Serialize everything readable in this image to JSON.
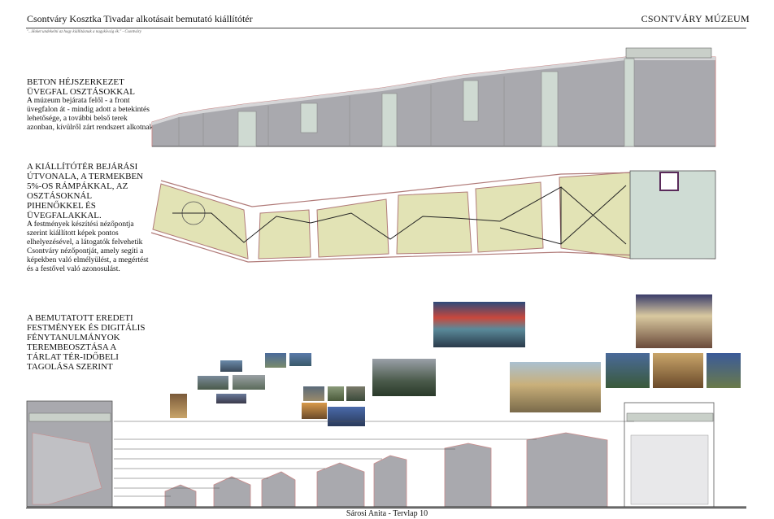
{
  "header": {
    "title": "Csontváry Kosztka Tivadar alkotásait bemutató kiállítótér",
    "right": "CSONTVÁRY MÚZEUM",
    "quote": "\"...Hoket undekelni az hogy kiállításnak a nagykövsig ék.\" - Csontváry"
  },
  "section1": {
    "title": "BETON HÉJSZERKEZET ÜVEGFAL OSZTÁSOKKAL",
    "body": "A múzeum bejárata felől - a front üvegfalon át - mindig adott a betekintés lehetősége, a további belső terek azonban, kívülről zárt rendszert alkotnak."
  },
  "section2": {
    "title": "A KIÁLLÍTÓTÉR BEJÁRÁSI ÚTVONALA, A TERMEKBEN 5%-OS RÁMPÁKKAL, AZ OSZTÁSOKNÁL PIHENŐKKEL ÉS ÜVEGFALAKKAL.",
    "body": "A festmények készítési nézőpontja szerint kiállított képek pontos elhelyezésével, a látogatók felvehetik Csontváry nézőpontját, amely segíti a képekben való elmélyülést, a megértést és a festővel való azonosulást."
  },
  "section3": {
    "title": "A BEMUTATOTT EREDETI FESTMÉNYEK ÉS DIGITÁLIS FÉNYTANULMÁNYOK TEREMBEOSZTÁSA A TÁRLAT TÉR-IDŐBELI TAGOLÁSA SZERINT"
  },
  "footer": "Sárosi Anita - Tervlap 10",
  "colors": {
    "concrete": "#a8a8ad",
    "concrete_dark": "#8e8e94",
    "glass": "#c9d8cf",
    "floor": "#e3e4b6",
    "outline": "#c98a8a"
  }
}
